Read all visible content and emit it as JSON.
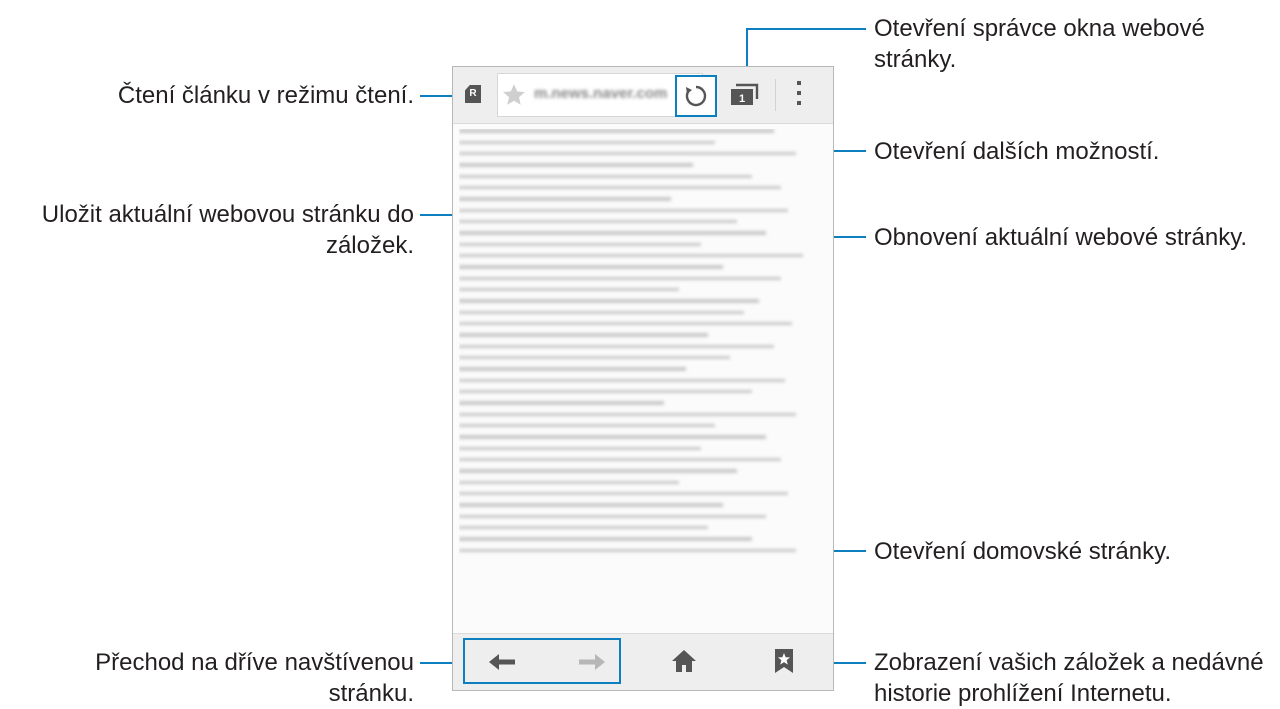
{
  "annotations": {
    "reader_mode": "Čtení článku v režimu čtení.",
    "bookmark_line1": "Uložit aktuální webovou stránku do",
    "bookmark_line2": "záložek.",
    "tab_manager_line1": "Otevření správce okna webové",
    "tab_manager_line2": "stránky.",
    "more_options": "Otevření dalších možností.",
    "refresh": "Obnovení aktuální webové stránky.",
    "home": "Otevření domovské stránky.",
    "back_forward_line1": "Přechod na dříve navštívenou",
    "back_forward_line2": "stránku.",
    "bookmarks_history_line1": "Zobrazení vašich záložek a nedávné",
    "bookmarks_history_line2": "historie prohlížení Internetu."
  },
  "browser": {
    "url": "m.news.naver.com",
    "tab_count": "1",
    "reader_badge": "R"
  },
  "icons": {
    "reader": "reader-mode-icon",
    "bookmark_star": "star-icon",
    "refresh": "refresh-icon",
    "tabs": "window-manager-icon",
    "more": "more-options-icon",
    "back": "arrow-left-icon",
    "forward": "arrow-right-icon",
    "home": "home-icon",
    "bookmarks": "bookmarks-icon"
  },
  "colors": {
    "accent": "#0d7fbf",
    "toolbar_bg": "#eeeeee",
    "icon_gray": "#555555"
  }
}
